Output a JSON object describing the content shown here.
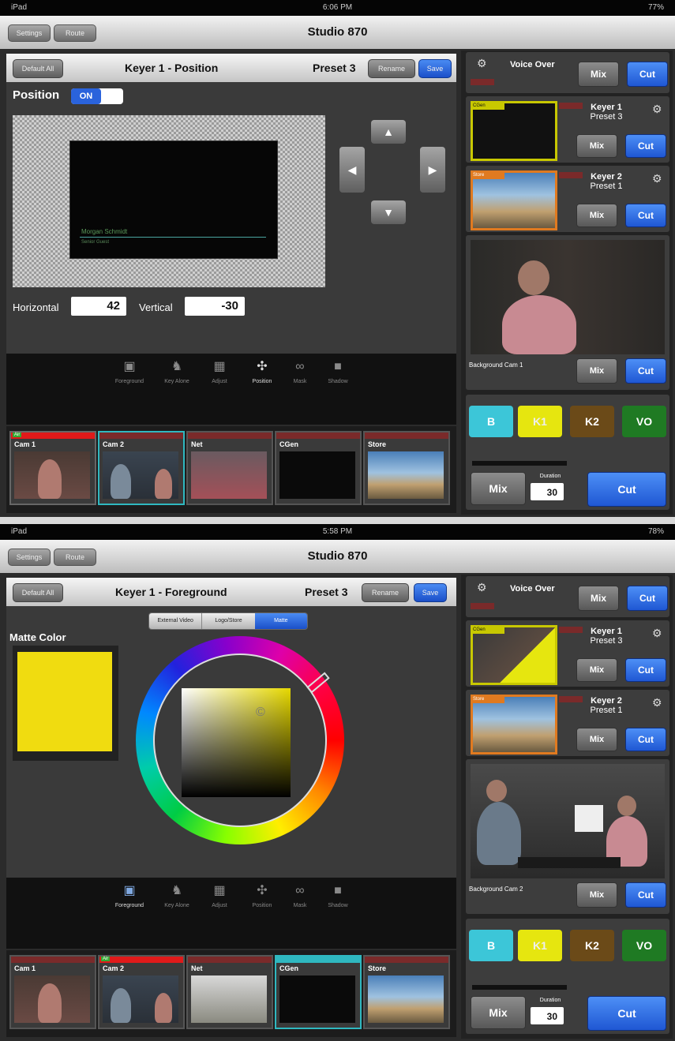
{
  "screen1": {
    "status": {
      "left": "iPad",
      "time": "6:06 PM",
      "right": "77%"
    },
    "nav": {
      "title": "Studio 870",
      "settings": "Settings",
      "route": "Route"
    },
    "header": {
      "default_all": "Default All",
      "title": "Keyer 1 - Position",
      "preset": "Preset 3",
      "rename": "Rename",
      "save": "Save"
    },
    "position_label": "Position",
    "toggle": "ON",
    "lower_third": {
      "line1": "Morgan Schmidt",
      "line2": "Senior Guest"
    },
    "horizontal_label": "Horizontal",
    "horizontal_value": "42",
    "vertical_label": "Vertical",
    "vertical_value": "-30",
    "icons": [
      {
        "label": "Foreground",
        "icon": "foreground-icon",
        "glyph": "▣"
      },
      {
        "label": "Key Alone",
        "icon": "key-alone-icon",
        "glyph": "♞"
      },
      {
        "label": "Adjust",
        "icon": "adjust-icon",
        "glyph": "▦"
      },
      {
        "label": "Position",
        "icon": "position-icon",
        "glyph": "✣"
      },
      {
        "label": "Mask",
        "icon": "mask-icon",
        "glyph": "∞"
      },
      {
        "label": "Shadow",
        "icon": "shadow-icon",
        "glyph": "■"
      }
    ],
    "sources": [
      {
        "label": "Cam 1",
        "tally": "Air"
      },
      {
        "label": "Cam 2"
      },
      {
        "label": "Net"
      },
      {
        "label": "CGen"
      },
      {
        "label": "Store"
      }
    ],
    "voice_over": {
      "label": "Voice Over",
      "mix": "Mix",
      "cut": "Cut"
    },
    "keyer1": {
      "name": "Keyer 1",
      "preset": "Preset 3",
      "tag": "CGen",
      "mix": "Mix",
      "cut": "Cut"
    },
    "keyer2": {
      "name": "Keyer 2",
      "preset": "Preset 1",
      "tag": "Store",
      "mix": "Mix",
      "cut": "Cut"
    },
    "background": {
      "label": "Background Cam 1",
      "mix": "Mix",
      "cut": "Cut"
    },
    "transition": {
      "b": "B",
      "k1": "K1",
      "k2": "K2",
      "vo": "VO",
      "mix": "Mix",
      "duration_label": "Duration",
      "duration": "30",
      "cut": "Cut"
    }
  },
  "screen2": {
    "status": {
      "left": "iPad",
      "time": "5:58 PM",
      "right": "78%"
    },
    "nav": {
      "title": "Studio 870",
      "settings": "Settings",
      "route": "Route"
    },
    "header": {
      "default_all": "Default All",
      "title": "Keyer 1 - Foreground",
      "preset": "Preset 3",
      "rename": "Rename",
      "save": "Save"
    },
    "segments": [
      "External Video",
      "Logo/Store",
      "Matte"
    ],
    "matte_label": "Matte Color",
    "matte_color": "#f0dc10",
    "icons": [
      {
        "label": "Foreground",
        "icon": "foreground-icon",
        "glyph": "▣"
      },
      {
        "label": "Key Alone",
        "icon": "key-alone-icon",
        "glyph": "♞"
      },
      {
        "label": "Adjust",
        "icon": "adjust-icon",
        "glyph": "▦"
      },
      {
        "label": "Position",
        "icon": "position-icon",
        "glyph": "✣"
      },
      {
        "label": "Mask",
        "icon": "mask-icon",
        "glyph": "∞"
      },
      {
        "label": "Shadow",
        "icon": "shadow-icon",
        "glyph": "■"
      }
    ],
    "sources": [
      {
        "label": "Cam 1"
      },
      {
        "label": "Cam 2",
        "tally": "Air"
      },
      {
        "label": "Net"
      },
      {
        "label": "CGen"
      },
      {
        "label": "Store"
      }
    ],
    "voice_over": {
      "label": "Voice Over",
      "mix": "Mix",
      "cut": "Cut"
    },
    "keyer1": {
      "name": "Keyer 1",
      "preset": "Preset 3",
      "tag": "CGen",
      "mix": "Mix",
      "cut": "Cut"
    },
    "keyer2": {
      "name": "Keyer 2",
      "preset": "Preset 1",
      "tag": "Store",
      "mix": "Mix",
      "cut": "Cut"
    },
    "background": {
      "label": "Background Cam 2",
      "mix": "Mix",
      "cut": "Cut"
    },
    "transition": {
      "b": "B",
      "k1": "K1",
      "k2": "K2",
      "vo": "VO",
      "mix": "Mix",
      "duration_label": "Duration",
      "duration": "30",
      "cut": "Cut"
    }
  },
  "colors": {
    "accent_blue": "#2a63dc",
    "tally_red": "#e01a1a",
    "b_cyan": "#3cc6d8",
    "k1_yellow": "#e6e60f",
    "k2_brown": "#6b4a18",
    "vo_green": "#1f7a23",
    "matte": "#f0dc10"
  }
}
